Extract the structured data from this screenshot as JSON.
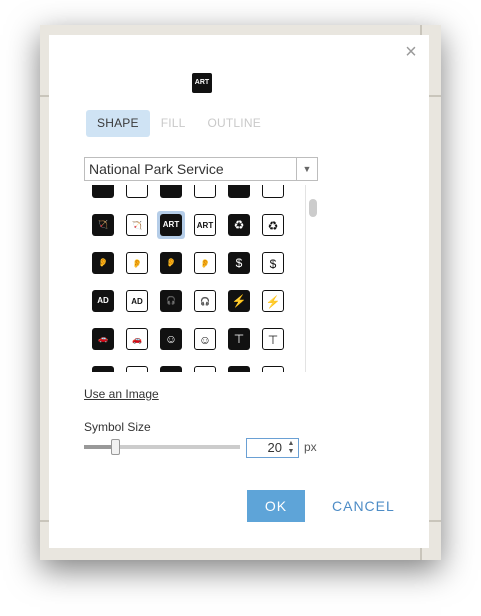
{
  "dialog": {
    "preview_icon": "art-icon",
    "preview_text": "ART",
    "close_glyph": "×",
    "tabs": [
      {
        "label": "SHAPE",
        "active": true
      },
      {
        "label": "FILL",
        "active": false
      },
      {
        "label": "OUTLINE",
        "active": false
      }
    ],
    "category": {
      "selected": "National Park Service"
    },
    "symbols": [
      {
        "icon": "partial-1-icon",
        "glyph": ""
      },
      {
        "icon": "partial-2-icon",
        "glyph": ""
      },
      {
        "icon": "partial-3-icon",
        "glyph": ""
      },
      {
        "icon": "partial-4-icon",
        "glyph": ""
      },
      {
        "icon": "partial-5-icon",
        "glyph": ""
      },
      {
        "icon": "partial-6-icon",
        "glyph": ""
      },
      {
        "icon": "archery-icon",
        "glyph": "🏹"
      },
      {
        "icon": "archery-outline-icon",
        "glyph": "🏹"
      },
      {
        "icon": "art-icon",
        "glyph": "ART"
      },
      {
        "icon": "art-outline-icon",
        "glyph": "ART"
      },
      {
        "icon": "recycling-icon",
        "glyph": "♻"
      },
      {
        "icon": "recycling-outline-icon",
        "glyph": "♻"
      },
      {
        "icon": "hearing-icon",
        "glyph": "👂"
      },
      {
        "icon": "hearing-outline-icon",
        "glyph": "👂"
      },
      {
        "icon": "hearing-t-icon",
        "glyph": "👂"
      },
      {
        "icon": "hearing-t-outline-icon",
        "glyph": "👂"
      },
      {
        "icon": "dollar-icon",
        "glyph": "$"
      },
      {
        "icon": "dollar-outline-icon",
        "glyph": "$"
      },
      {
        "icon": "audio-description-icon",
        "glyph": "AD"
      },
      {
        "icon": "audio-description-outline-icon",
        "glyph": "AD"
      },
      {
        "icon": "headphones-icon",
        "glyph": "🎧"
      },
      {
        "icon": "headphones-outline-icon",
        "glyph": "🎧"
      },
      {
        "icon": "fire-icon",
        "glyph": "⚡"
      },
      {
        "icon": "fire-outline-icon",
        "glyph": "⚡"
      },
      {
        "icon": "car-icon",
        "glyph": "🚗"
      },
      {
        "icon": "car-outline-icon",
        "glyph": "🚗"
      },
      {
        "icon": "baby-icon",
        "glyph": "☺"
      },
      {
        "icon": "baby-outline-icon",
        "glyph": "☺"
      },
      {
        "icon": "table-icon",
        "glyph": "⊤"
      },
      {
        "icon": "table-outline-icon",
        "glyph": "⊤"
      },
      {
        "icon": "partial-7-icon",
        "glyph": ""
      },
      {
        "icon": "partial-8-icon",
        "glyph": ""
      },
      {
        "icon": "partial-9-icon",
        "glyph": ""
      },
      {
        "icon": "partial-10-icon",
        "glyph": ""
      },
      {
        "icon": "partial-11-icon",
        "glyph": ""
      },
      {
        "icon": "partial-12-icon",
        "glyph": ""
      }
    ],
    "use_image_label": "Use an Image",
    "symbol_size": {
      "label": "Symbol Size",
      "value": "20",
      "unit": "px",
      "level_fraction": 0.2
    },
    "ok_label": "OK",
    "cancel_label": "CANCEL"
  }
}
